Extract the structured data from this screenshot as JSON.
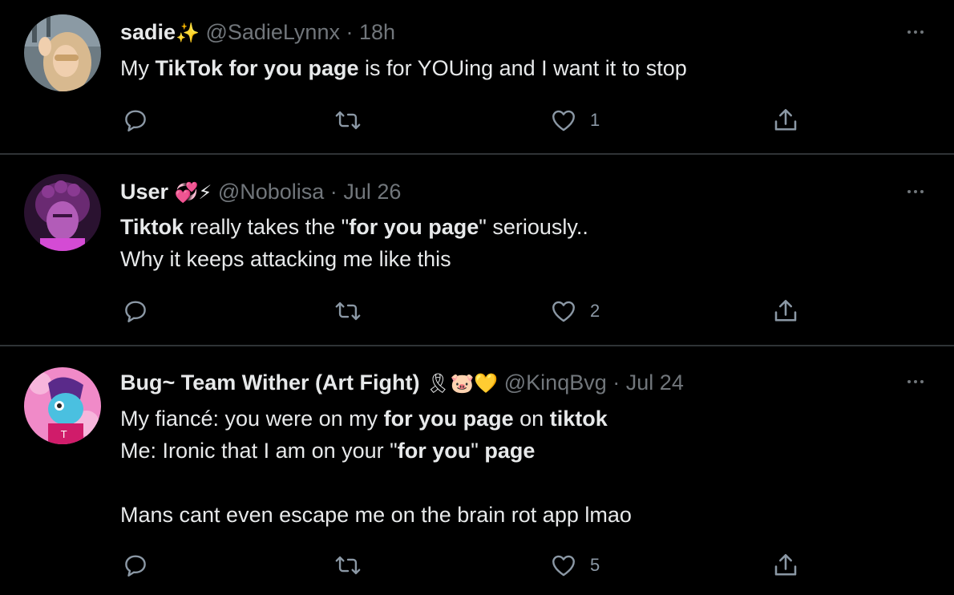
{
  "tweets": [
    {
      "name": "sadie",
      "name_emoji": "✨",
      "handle": "@SadieLynnx",
      "separator": "·",
      "time": "18h",
      "lines": [
        [
          {
            "t": "My "
          },
          {
            "t": "TikTok for you page",
            "b": true
          },
          {
            "t": " is for YOUing and I want it to stop"
          }
        ]
      ],
      "likes": "1"
    },
    {
      "name": "User",
      "name_emoji": "💞⚡",
      "handle": "@Nobolisa",
      "separator": "·",
      "time": "Jul 26",
      "lines": [
        [
          {
            "t": "Tiktok",
            "b": true
          },
          {
            "t": " really takes the \""
          },
          {
            "t": "for you page",
            "b": true
          },
          {
            "t": "\" seriously.."
          }
        ],
        [
          {
            "t": "Why it keeps attacking me like this"
          }
        ]
      ],
      "likes": "2"
    },
    {
      "name": "Bug~ Team Wither (Art Fight)",
      "name_emoji": "🎗🐷💛",
      "handle": "@KinqBvg",
      "separator": "·",
      "time": "Jul 24",
      "lines": [
        [
          {
            "t": "My fiancé: you were on my "
          },
          {
            "t": "for you page",
            "b": true
          },
          {
            "t": " on "
          },
          {
            "t": "tiktok",
            "b": true
          }
        ],
        [
          {
            "t": "Me: Ironic that I am on your \""
          },
          {
            "t": "for you",
            "b": true
          },
          {
            "t": "\" "
          },
          {
            "t": "page",
            "b": true
          }
        ],
        [
          {
            "t": ""
          }
        ],
        [
          {
            "t": "Mans cant even escape me on the brain rot app lmao"
          }
        ]
      ],
      "likes": "5"
    }
  ],
  "icons": {
    "reply": "reply-icon",
    "retweet": "retweet-icon",
    "like": "heart-icon",
    "share": "share-icon",
    "more": "more-icon"
  },
  "colors": {
    "background": "#000000",
    "text": "#e7e9ea",
    "muted": "#71767b",
    "divider": "#2f3336"
  }
}
